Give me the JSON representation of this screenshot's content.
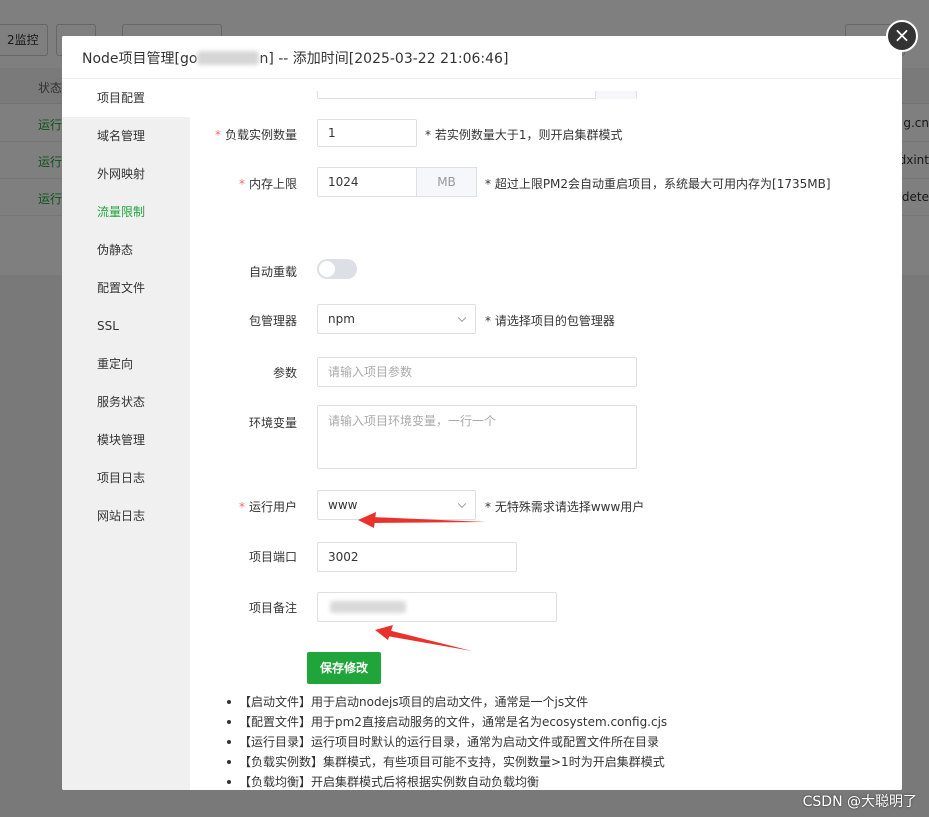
{
  "background": {
    "toolbar": {
      "pm2_button": "2监控",
      "button2": "",
      "button3": ""
    },
    "table": {
      "status_header": "状态",
      "rows": [
        {
          "status": "运行",
          "right": "g.cn"
        },
        {
          "status": "运行",
          "right": "dxint"
        },
        {
          "status": "运行",
          "right": "dete"
        }
      ]
    }
  },
  "modal": {
    "title_prefix": "Node项目管理[go",
    "title_suffix": "n] -- 添加时间[2025-03-22 21:06:46]",
    "close_symbol": "×"
  },
  "sidebar": {
    "items": [
      {
        "label": "项目配置"
      },
      {
        "label": "域名管理"
      },
      {
        "label": "外网映射"
      },
      {
        "label": "流量限制"
      },
      {
        "label": "伪静态"
      },
      {
        "label": "配置文件"
      },
      {
        "label": "SSL"
      },
      {
        "label": "重定向"
      },
      {
        "label": "服务状态"
      },
      {
        "label": "模块管理"
      },
      {
        "label": "项目日志"
      },
      {
        "label": "网站日志"
      }
    ]
  },
  "form": {
    "instances": {
      "label": "负载实例数量",
      "required_mark": "*",
      "value": "1",
      "hint": "* 若实例数量大于1，则开启集群模式"
    },
    "memory": {
      "label": "内存上限",
      "required_mark": "*",
      "value": "1024",
      "unit": "MB",
      "hint": "* 超过上限PM2会自动重启项目，系统最大可用内存为[1735MB]"
    },
    "auto_reload": {
      "label": "自动重载",
      "enabled": false
    },
    "package_manager": {
      "label": "包管理器",
      "value": "npm",
      "hint": "* 请选择项目的包管理器"
    },
    "params": {
      "label": "参数",
      "placeholder": "请输入项目参数"
    },
    "env": {
      "label": "环境变量",
      "placeholder": "请输入项目环境变量，一行一个"
    },
    "run_user": {
      "label": "运行用户",
      "required_mark": "*",
      "value": "www",
      "hint": "* 无特殊需求请选择www用户"
    },
    "port": {
      "label": "项目端口",
      "value": "3002"
    },
    "remark": {
      "label": "项目备注",
      "value": ""
    },
    "save_label": "保存修改"
  },
  "tips": [
    "【启动文件】用于启动nodejs项目的启动文件，通常是一个js文件",
    "【配置文件】用于pm2直接启动服务的文件，通常是名为ecosystem.config.cjs",
    "【运行目录】运行项目时默认的运行目录，通常为启动文件或配置文件所在目录",
    "【负载实例数】集群模式，有些项目可能不支持，实例数量>1时为开启集群模式",
    "【负载均衡】开启集群模式后将根据实例数自动负载均衡"
  ],
  "watermark": "CSDN @大聪明了",
  "colors": {
    "accent": "#20a53a",
    "required": "#f56c6c",
    "annotation_arrow": "#e8322b"
  }
}
